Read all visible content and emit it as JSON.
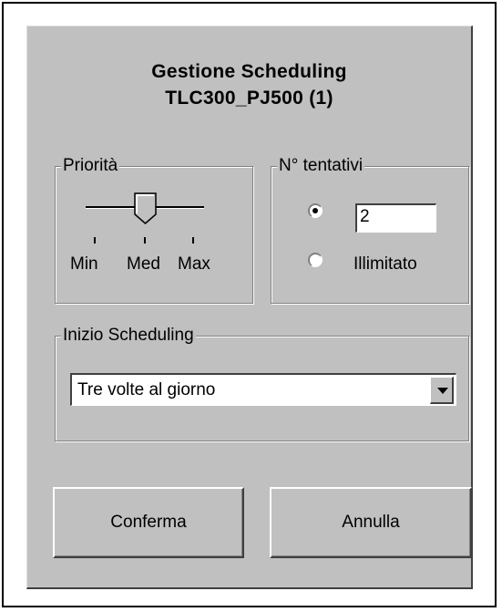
{
  "dialog": {
    "title_line1": "Gestione Scheduling",
    "title_line2": "TLC300_PJ500 (1)"
  },
  "priority": {
    "label": "Priorità",
    "levels": [
      "Min",
      "Med",
      "Max"
    ],
    "selected_level": "Med"
  },
  "attempts": {
    "label": "N° tentativi",
    "value": "2",
    "unlimited_label": "Illimitato",
    "selected_option": "count"
  },
  "schedule_start": {
    "label": "Inizio Scheduling",
    "selected": "Tre volte al giorno"
  },
  "buttons": {
    "confirm": "Conferma",
    "cancel": "Annulla"
  },
  "colors": {
    "dialog_bg": "#c0c0c0",
    "shadow": "#404040",
    "highlight": "#ffffff"
  }
}
